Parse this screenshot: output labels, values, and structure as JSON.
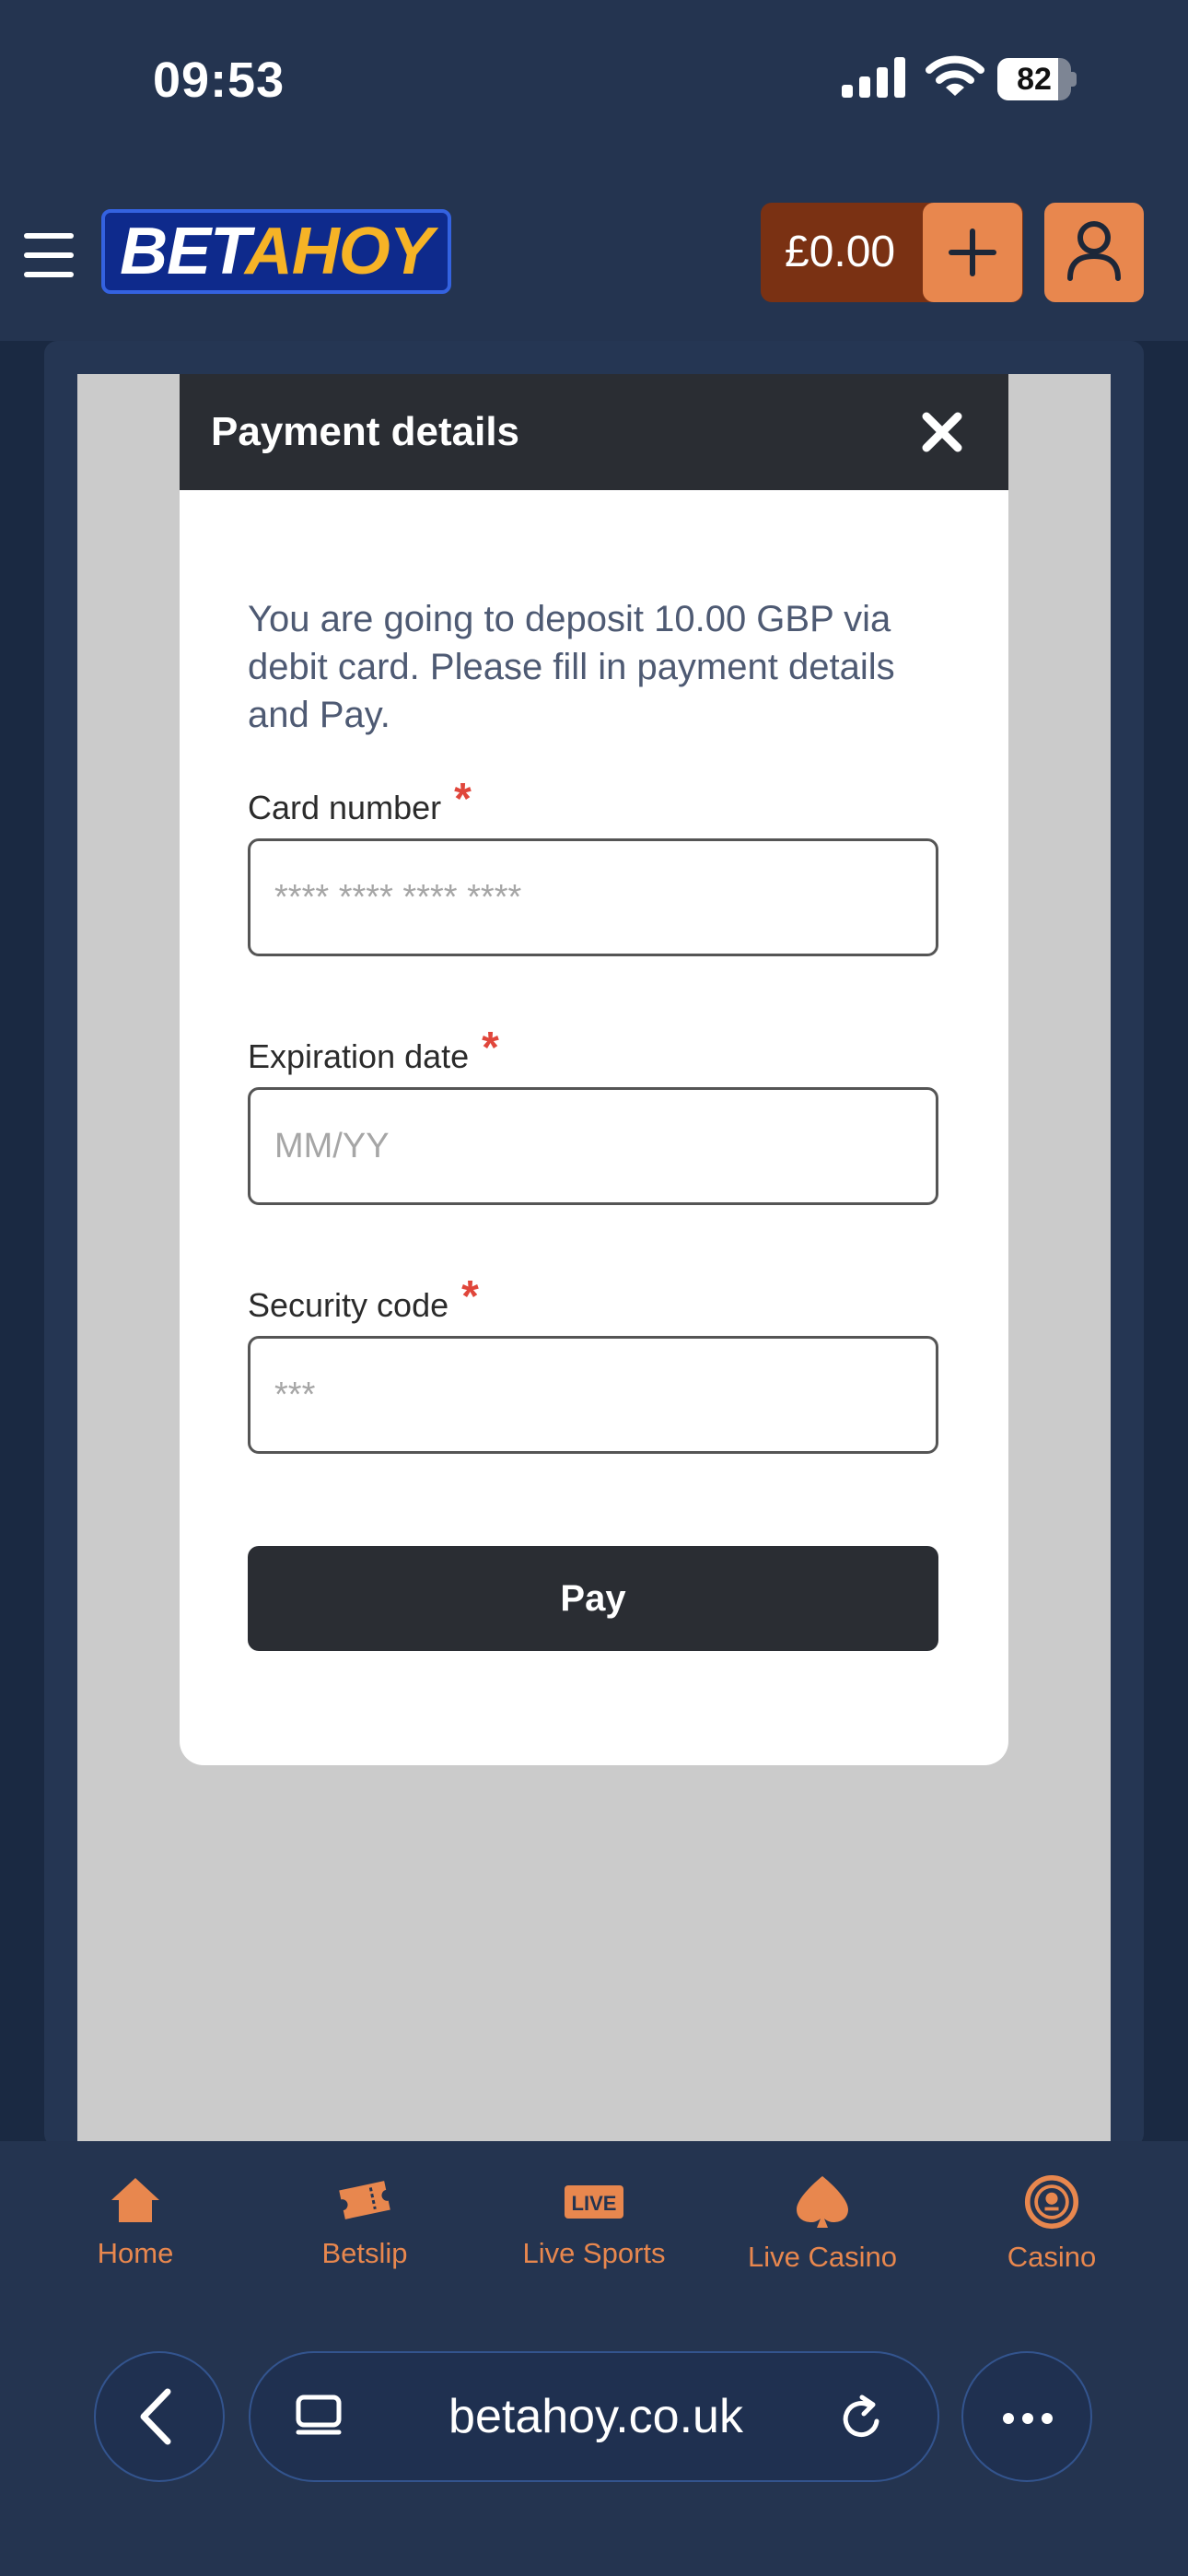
{
  "status_bar": {
    "time": "09:53",
    "battery": "82",
    "battery_level": 0.82
  },
  "header": {
    "logo_part1": "BET",
    "logo_part2": "AHOY",
    "balance": "£0.00"
  },
  "modal": {
    "title": "Payment details",
    "intro": "You are going to deposit 10.00 GBP via debit card. Please fill in payment details and Pay.",
    "required_marker": "*",
    "fields": [
      {
        "label": "Card number",
        "placeholder": "**** **** **** ****",
        "value": ""
      },
      {
        "label": "Expiration date",
        "placeholder": "MM/YY",
        "value": ""
      },
      {
        "label": "Security code",
        "placeholder": "***",
        "value": ""
      }
    ],
    "pay_label": "Pay"
  },
  "bottom_nav": {
    "items": [
      {
        "label": "Home",
        "icon": "home-icon"
      },
      {
        "label": "Betslip",
        "icon": "ticket-icon"
      },
      {
        "label": "Live Sports",
        "icon": "live-icon",
        "badge": "LIVE"
      },
      {
        "label": "Live Casino",
        "icon": "spade-icon"
      },
      {
        "label": "Casino",
        "icon": "chip-icon"
      }
    ]
  },
  "browser": {
    "url": "betahoy.co.uk"
  },
  "colors": {
    "accent": "#e8874e",
    "background": "#243450",
    "balance_bg": "#7a3113",
    "modal_header": "#2a2d33",
    "required": "#e0463b"
  }
}
